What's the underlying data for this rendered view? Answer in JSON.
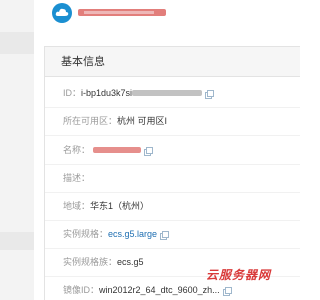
{
  "panel": {
    "title": "基本信息"
  },
  "fields": {
    "id": {
      "label": "ID：",
      "value": "i-bp1du3k7si"
    },
    "zone": {
      "label": "所在可用区：",
      "value": "杭州 可用区I"
    },
    "name": {
      "label": "名称："
    },
    "description": {
      "label": "描述："
    },
    "region": {
      "label": "地域：",
      "value": "华东1（杭州）"
    },
    "spec": {
      "label": "实例规格：",
      "value": "ecs.g5.large"
    },
    "family": {
      "label": "实例规格族：",
      "value": "ecs.g5"
    },
    "image": {
      "label": "镜像ID：",
      "value": "win2012r2_64_dtc_9600_zh..."
    }
  },
  "watermark": "云服务器网"
}
